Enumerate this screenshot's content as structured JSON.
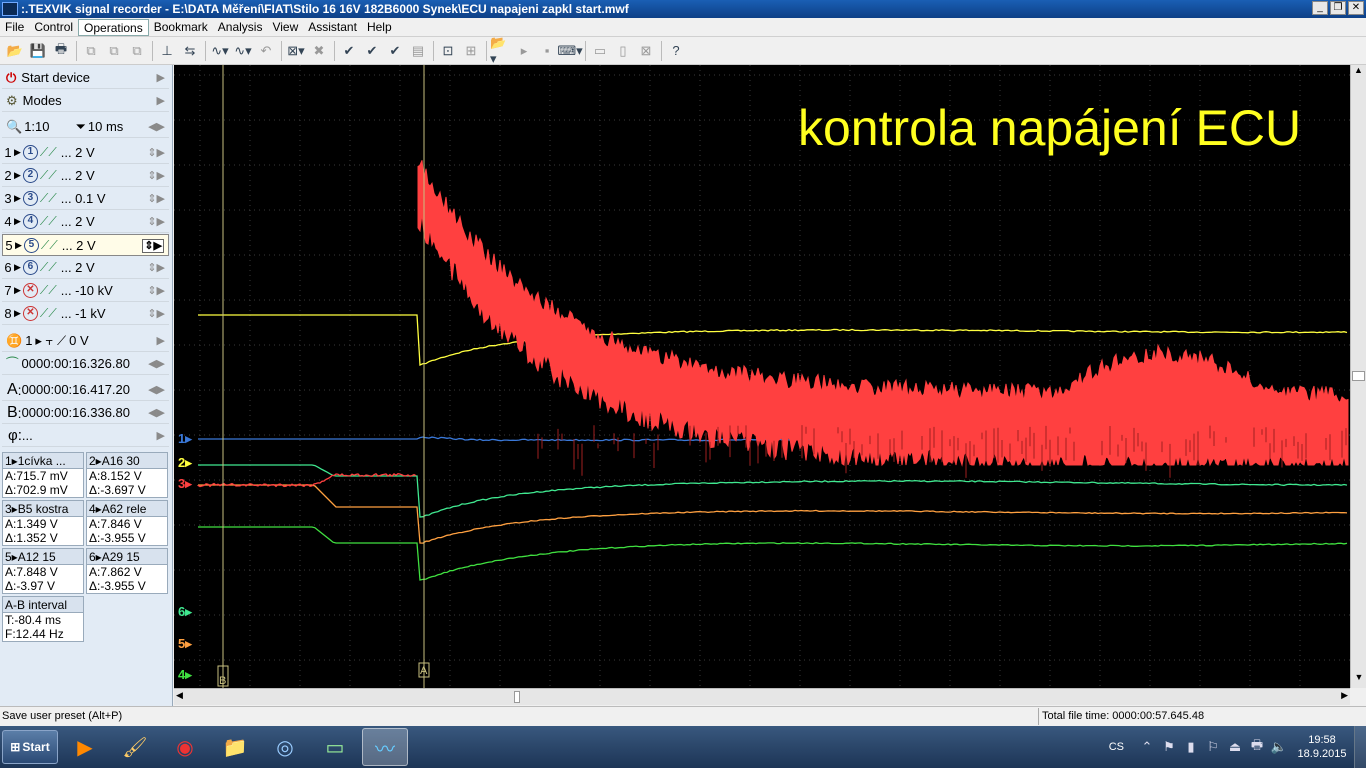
{
  "titlebar": {
    "title": ":.TEXVIK  signal recorder - E:\\DATA Měření\\FIAT\\Stilo 16 16V 182B6000 Synek\\ECU napajeni zapkl start.mwf"
  },
  "menu": [
    "File",
    "Control",
    "Operations",
    "Bookmark",
    "Analysis",
    "View",
    "Assistant",
    "Help"
  ],
  "left": {
    "start_device": "Start device",
    "modes": "Modes",
    "zoom": "1:10",
    "time_div": "10 ms",
    "channels": [
      {
        "num": "1",
        "circ": "1",
        "scale": "... 2 V"
      },
      {
        "num": "2",
        "circ": "2",
        "scale": "... 2 V"
      },
      {
        "num": "3",
        "circ": "3",
        "scale": "... 0.1 V"
      },
      {
        "num": "4",
        "circ": "4",
        "scale": "... 2 V"
      },
      {
        "num": "5",
        "circ": "5",
        "scale": "... 2 V"
      },
      {
        "num": "6",
        "circ": "6",
        "scale": "... 2 V"
      },
      {
        "num": "7",
        "circ": "✕",
        "scale": "... -10 kV"
      },
      {
        "num": "8",
        "circ": "✕",
        "scale": "... -1 kV"
      }
    ],
    "trigger_channel": "1",
    "trigger_level": "0 V",
    "trigger_time": "0000:00:16.326.80",
    "cursor_a": "0000:00:16.417.20",
    "cursor_b": "0000:00:16.336.80",
    "phi": "..."
  },
  "measure": [
    {
      "head": "1▸1cívka ...",
      "a": "A:715.7 mV",
      "d": "Δ:702.9 mV"
    },
    {
      "head": "2▸A16 30",
      "a": "A:8.152 V",
      "d": "Δ:-3.697 V"
    },
    {
      "head": "3▸B5 kostra",
      "a": "A:1.349 V",
      "d": "Δ:1.352 V"
    },
    {
      "head": "4▸A62 rele",
      "a": "A:7.846 V",
      "d": "Δ:-3.955 V"
    },
    {
      "head": "5▸A12 15",
      "a": "A:7.848 V",
      "d": "Δ:-3.97 V"
    },
    {
      "head": "6▸A29 15",
      "a": "A:7.862 V",
      "d": "Δ:-3.955 V"
    }
  ],
  "interval": {
    "head": "A-B interval",
    "t": "T:-80.4 ms",
    "f": "F:12.44 Hz"
  },
  "scope": {
    "annotation": "kontrola napájení ECU",
    "markers": {
      "a": "A",
      "b": "B"
    },
    "ch_labels": [
      "1",
      "2",
      "3",
      "6",
      "5",
      "4"
    ],
    "colors": {
      "ch1": "#3a78d8",
      "ch2": "#ffff40",
      "ch3": "#ff4040",
      "ch4": "#40e040",
      "ch5": "#ffa040",
      "ch6": "#40e890",
      "grid": "#3a3a3a",
      "cursor": "#c8c080"
    }
  },
  "status": {
    "left": "Save user preset (Alt+P)",
    "right": "Total file time: 0000:00:57.645.48"
  },
  "taskbar": {
    "start": "Start",
    "lang": "CS",
    "time": "19:58",
    "date": "18.9.2015"
  }
}
